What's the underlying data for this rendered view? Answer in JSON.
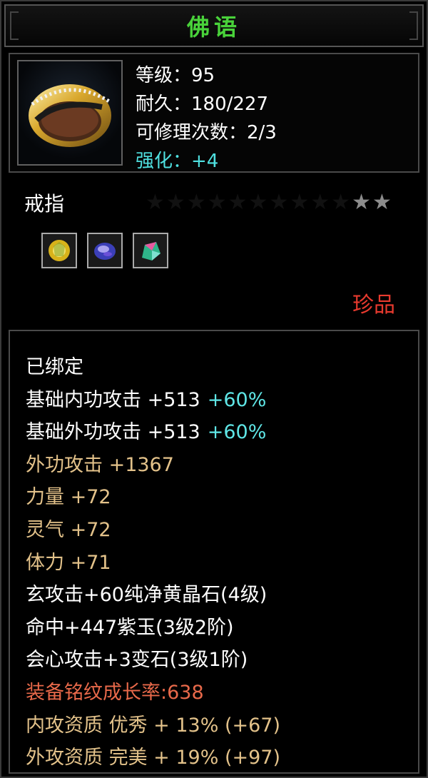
{
  "title": "佛语",
  "item": {
    "icon": "gold-ring-icon",
    "stats": [
      "等级：95",
      "耐久：180/227",
      "可修理次数：2/3"
    ],
    "enhance": "强化：+4"
  },
  "type_label": "戒指",
  "stars": {
    "total": 12,
    "filled": 2
  },
  "gems": [
    "yellow-gem-icon",
    "purple-gem-icon",
    "rainbow-gem-icon"
  ],
  "rarity": "珍品",
  "bound": "已绑定",
  "base_attrs": [
    {
      "label": "基础内功攻击 +513",
      "pct": "+60%"
    },
    {
      "label": "基础外功攻击 +513",
      "pct": "+60%"
    }
  ],
  "bonus_attrs": [
    "外功攻击 +1367",
    "力量 +72",
    "灵气 +72",
    "体力 +71"
  ],
  "gem_attrs": [
    "玄攻击+60纯净黄晶石(4级)",
    "命中+447紫玉(3级2阶)",
    "会心攻击+3变石(3级1阶)"
  ],
  "growth": "装备铭纹成长率:638",
  "qualities": [
    "内攻资质 优秀 + 13% (+67)",
    "外攻资质 完美 + 19% (+97)"
  ],
  "colors": {
    "title": "#49d23a",
    "enhance": "#4fe0e0",
    "rarity": "#e83a2e",
    "bonus": "#e3c28a",
    "growth": "#e8694a"
  }
}
